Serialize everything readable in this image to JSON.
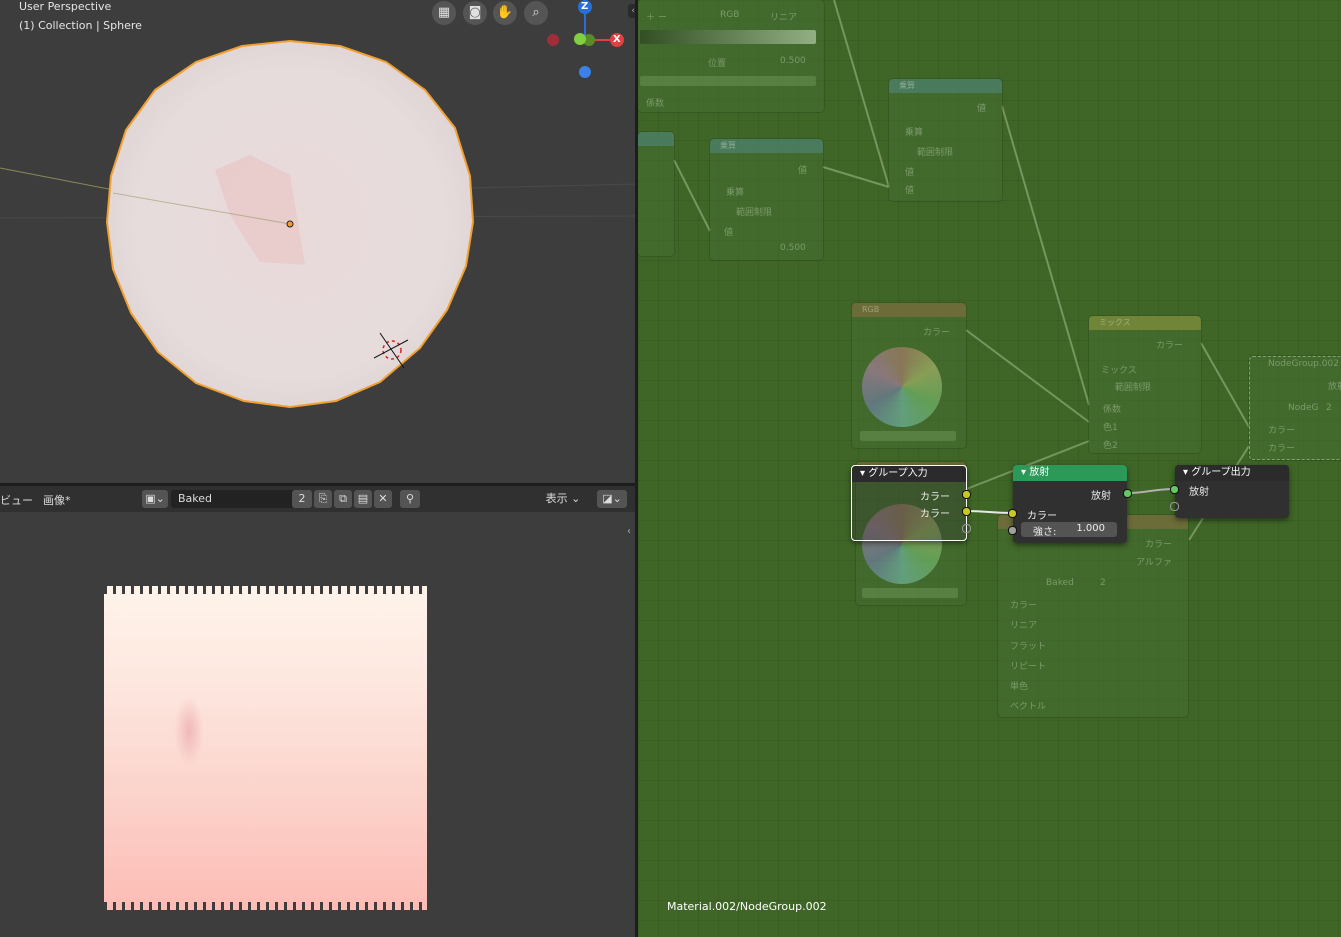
{
  "viewport": {
    "title": "User Perspective",
    "subtitle": "(1) Collection | Sphere",
    "nav_icons": [
      "grid-view-icon",
      "camera-icon",
      "hand-icon",
      "zoom-icon"
    ],
    "axes": {
      "z": "Z",
      "x": "X"
    }
  },
  "image_editor": {
    "view_menu": "ビュー",
    "image_menu": "画像*",
    "image_name": "Baked",
    "users": "2",
    "display_menu": "表示"
  },
  "node_editor": {
    "breadcrumb": "Material.002/NodeGroup.002",
    "group_input": {
      "title": "グループ入力",
      "out1": "カラー",
      "out2": "カラー"
    },
    "emission": {
      "title": "放射",
      "out": "放射",
      "in_color": "カラー",
      "strength_label": "強さ:",
      "strength": "1.000"
    },
    "group_output": {
      "title": "グループ出力",
      "in": "放射"
    },
    "ghosts": {
      "rgb_title": "RGB",
      "rgb_out": "カラー",
      "mix_title": "ミックス",
      "mix_out": "カラー",
      "mix_mode": "ミックス",
      "mix_clamp": "範囲制限",
      "mix_fac": "係数",
      "mix_c1": "色1",
      "mix_c2": "色2",
      "math1_title": "乗算",
      "math1_out": "値",
      "math1_mode": "乗算",
      "math1_clamp": "範囲制限",
      "math1_in": "値",
      "math2_title": "乗算",
      "math2_out": "値",
      "math2_mode": "乗算",
      "math2_clamp": "範囲制限",
      "math2_in": "値",
      "math2_val": "0.500",
      "ramp_rgb": "RGB",
      "ramp_linear": "リニア",
      "ramp_pos": "位置",
      "ramp_val": "0.500",
      "ramp_fac": "係数",
      "img_name": "Baked",
      "img_users": "2",
      "img_color": "カラー",
      "img_alpha": "アルファ",
      "img_opts": [
        "カラー",
        "リニア",
        "フラット",
        "リピート",
        "単色"
      ],
      "img_vector": "ベクトル",
      "nodegroup_title": "NodeGroup.002",
      "nodegroup_field": "NodeG",
      "nodegroup_users": "2",
      "nodegroup_out": "放射",
      "nodegroup_in1": "カラー",
      "nodegroup_in2": "カラー"
    }
  }
}
